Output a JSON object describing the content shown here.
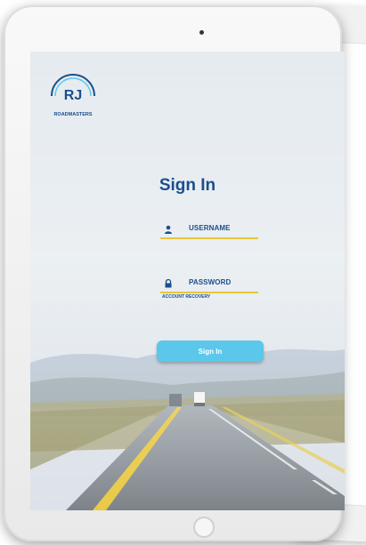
{
  "app": {
    "logo_text": "RJ",
    "logo_caption": "ROADMASTERS"
  },
  "login": {
    "title": "Sign In",
    "username_label": "USERNAME",
    "password_label": "PASSWORD",
    "account_recovery": "ACCOUNT RECOVERY",
    "signin_button": "Sign In"
  },
  "colors": {
    "brand_blue": "#1b4f8c",
    "underline_yellow": "#e7c83a",
    "button_cyan": "#5bc7ea"
  },
  "icons": {
    "username": "user-icon",
    "password": "lock-icon"
  }
}
